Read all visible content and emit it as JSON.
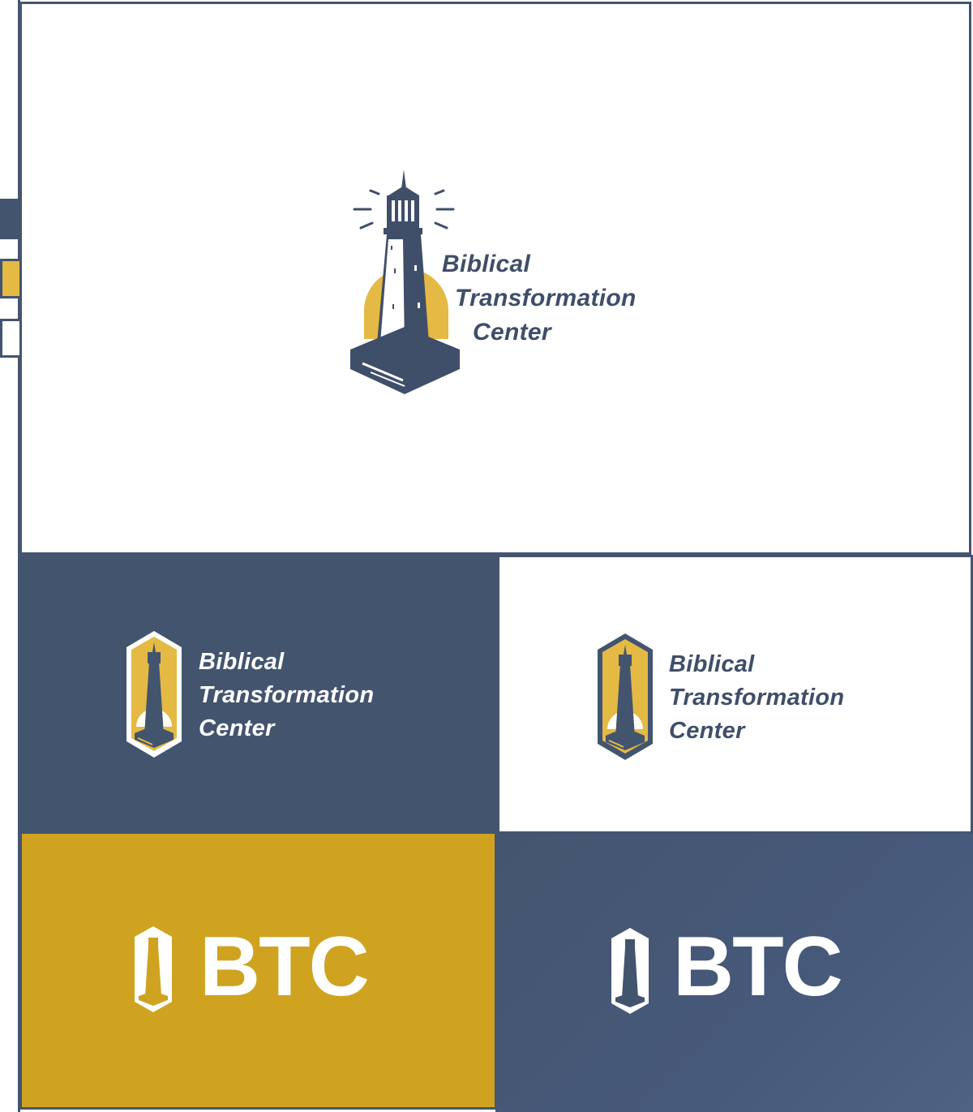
{
  "colors": {
    "navy": "#43546f",
    "gold": "#cfa31f",
    "gold_light": "#e4b944",
    "white": "#ffffff"
  },
  "swatches": [
    {
      "name": "navy",
      "color": "#43546f"
    },
    {
      "name": "gold",
      "color": "#e4b944"
    },
    {
      "name": "white",
      "color": "#ffffff"
    }
  ],
  "logo": {
    "line1": "Biblical",
    "line2": "Transformation",
    "line3": "Center",
    "abbreviation": "BTC"
  },
  "icons": {
    "primary": "lighthouse-icon",
    "badge": "lighthouse-badge-icon"
  }
}
